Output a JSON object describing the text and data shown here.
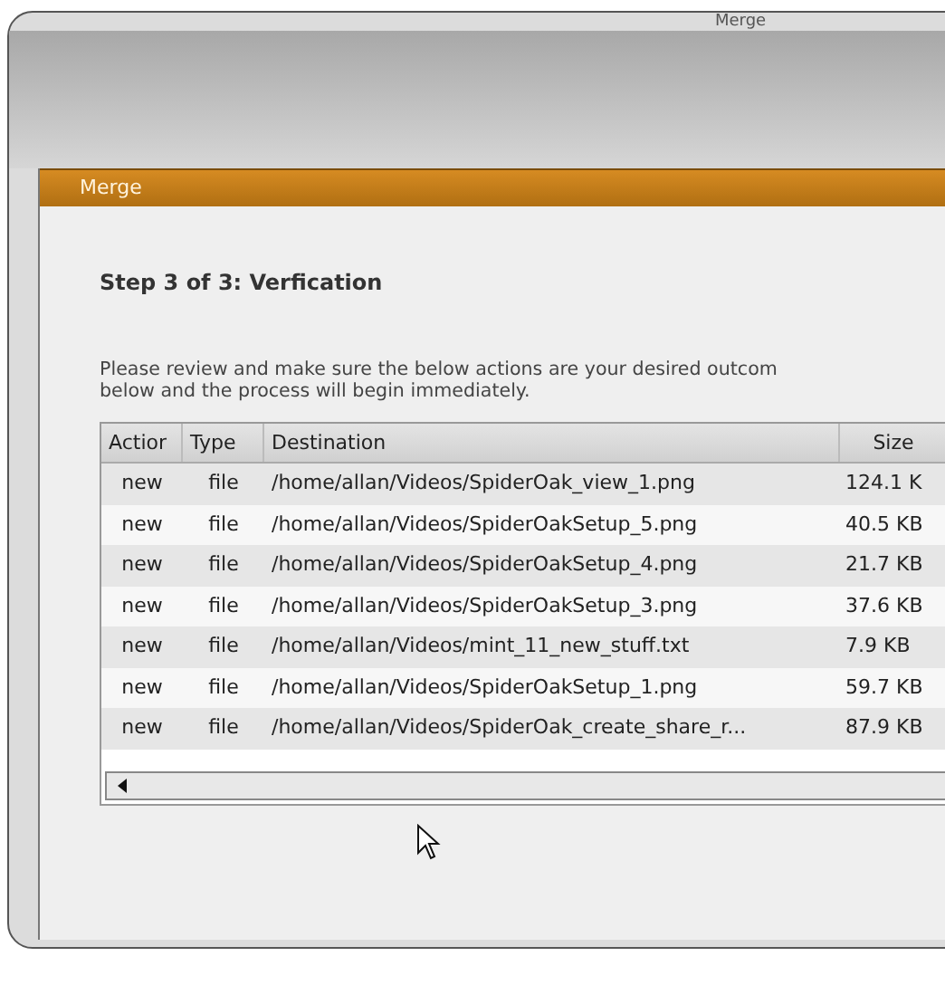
{
  "window": {
    "title": "Merge"
  },
  "dialog": {
    "title": "Merge",
    "step": "Step 3 of 3: Verfication",
    "instructions": [
      "Please review and make sure the below actions are your desired outcom",
      "below and the process will begin immediately."
    ]
  },
  "table": {
    "columns": [
      "Actior",
      "Type",
      "Destination",
      "Size"
    ],
    "rows": [
      {
        "action": "new",
        "type": "file",
        "destination": "/home/allan/Videos/SpiderOak_view_1.png",
        "size": "124.1 K"
      },
      {
        "action": "new",
        "type": "file",
        "destination": "/home/allan/Videos/SpiderOakSetup_5.png",
        "size": "40.5 KB"
      },
      {
        "action": "new",
        "type": "file",
        "destination": "/home/allan/Videos/SpiderOakSetup_4.png",
        "size": "21.7 KB"
      },
      {
        "action": "new",
        "type": "file",
        "destination": "/home/allan/Videos/SpiderOakSetup_3.png",
        "size": "37.6 KB"
      },
      {
        "action": "new",
        "type": "file",
        "destination": "/home/allan/Videos/mint_11_new_stuff.txt",
        "size": "7.9 KB"
      },
      {
        "action": "new",
        "type": "file",
        "destination": "/home/allan/Videos/SpiderOakSetup_1.png",
        "size": "59.7 KB"
      },
      {
        "action": "new",
        "type": "file",
        "destination": "/home/allan/Videos/SpiderOak_create_share_r...",
        "size": "87.9 KB"
      }
    ]
  }
}
